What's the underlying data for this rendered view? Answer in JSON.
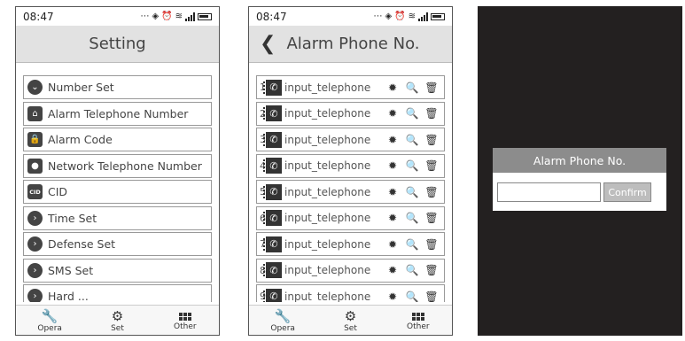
{
  "status": {
    "time": "08:47"
  },
  "setting_screen": {
    "title": "Setting",
    "items": [
      {
        "label": "Number Set",
        "icon": "chevron-down-icon"
      },
      {
        "label": "Alarm Telephone Number",
        "icon": "house-icon"
      },
      {
        "label": "Alarm Code",
        "icon": "lock-icon"
      },
      {
        "label": "Network Telephone Number",
        "icon": "person-icon"
      },
      {
        "label": "CID",
        "icon": "cid-icon"
      },
      {
        "label": "Time Set",
        "icon": "chevron-right-icon"
      },
      {
        "label": "Defense Set",
        "icon": "chevron-right-icon"
      },
      {
        "label": "SMS Set",
        "icon": "chevron-right-icon"
      },
      {
        "label": "Hard ...",
        "icon": "chevron-right-icon"
      }
    ]
  },
  "phone_screen": {
    "title": "Alarm Phone No.",
    "items": [
      {
        "num": "1",
        "label": "input_telephone"
      },
      {
        "num": "2",
        "label": "input_telephone"
      },
      {
        "num": "3",
        "label": "input_telephone"
      },
      {
        "num": "4",
        "label": "input_telephone"
      },
      {
        "num": "5",
        "label": "input_telephone"
      },
      {
        "num": "6",
        "label": "input_telephone"
      },
      {
        "num": "7",
        "label": "input_telephone"
      },
      {
        "num": "8",
        "label": "input_telephone"
      },
      {
        "num": "9",
        "label": "input_telephone"
      }
    ]
  },
  "tabbar": {
    "opera": "Opera",
    "set": "Set",
    "other": "Other"
  },
  "dialog": {
    "title": "Alarm Phone No.",
    "input_value": "",
    "confirm": "Confirm"
  }
}
